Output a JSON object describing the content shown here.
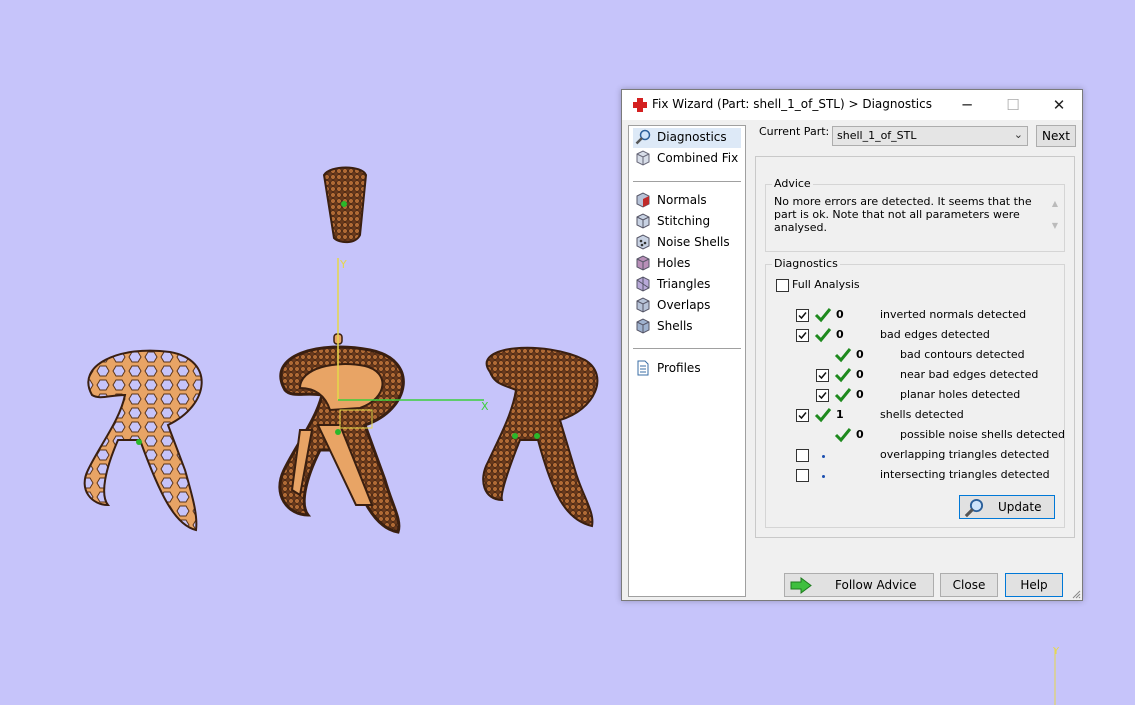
{
  "dialog": {
    "title": "Fix Wizard (Part: shell_1_of_STL) > Diagnostics",
    "window_controls": {
      "minimize": "─",
      "maximize": "☐",
      "close": "✕"
    }
  },
  "nav": {
    "top_items": [
      {
        "label": "Diagnostics",
        "icon": "magnifier-icon",
        "selected": true
      },
      {
        "label": "Combined Fix",
        "icon": "cube-icon"
      }
    ],
    "fix_items": [
      {
        "label": "Normals",
        "icon": "normals-cube-icon"
      },
      {
        "label": "Stitching",
        "icon": "stitching-cube-icon"
      },
      {
        "label": "Noise Shells",
        "icon": "noise-shells-icon"
      },
      {
        "label": "Holes",
        "icon": "holes-cube-icon"
      },
      {
        "label": "Triangles",
        "icon": "triangles-cube-icon"
      },
      {
        "label": "Overlaps",
        "icon": "overlaps-cube-icon"
      },
      {
        "label": "Shells",
        "icon": "shells-cube-icon"
      }
    ],
    "profiles": {
      "label": "Profiles",
      "icon": "document-icon"
    }
  },
  "current_part": {
    "label": "Current Part:",
    "value": "shell_1_of_STL",
    "next_label": "Next"
  },
  "advice": {
    "title": "Advice",
    "text": "No more errors are detected. It seems that the part is ok. Note that not all parameters were analysed."
  },
  "diagnostics": {
    "title": "Diagnostics",
    "full_analysis_label": "Full Analysis",
    "full_analysis_checked": false,
    "rows": [
      {
        "checkbox": true,
        "checked": true,
        "status": "ok",
        "count": "0",
        "text": "inverted normals detected",
        "indent": 0
      },
      {
        "checkbox": true,
        "checked": true,
        "status": "ok",
        "count": "0",
        "text": "bad edges detected",
        "indent": 0
      },
      {
        "checkbox": false,
        "checked": false,
        "status": "ok",
        "count": "0",
        "text": "bad contours detected",
        "indent": 1
      },
      {
        "checkbox": true,
        "checked": true,
        "status": "ok",
        "count": "0",
        "text": "near bad edges detected",
        "indent": 1
      },
      {
        "checkbox": true,
        "checked": true,
        "status": "ok",
        "count": "0",
        "text": "planar holes detected",
        "indent": 1
      },
      {
        "checkbox": true,
        "checked": true,
        "status": "ok",
        "count": "1",
        "text": "shells detected",
        "indent": 0
      },
      {
        "checkbox": false,
        "checked": false,
        "status": "ok",
        "count": "0",
        "text": "possible noise shells detected",
        "indent": 1
      },
      {
        "checkbox": true,
        "checked": false,
        "status": "dot",
        "count": "",
        "text": "overlapping triangles detected",
        "indent": 0
      },
      {
        "checkbox": true,
        "checked": false,
        "status": "dot",
        "count": "",
        "text": "intersecting triangles detected",
        "indent": 0
      }
    ],
    "update_label": "Update"
  },
  "footer": {
    "follow_advice_label": "Follow Advice",
    "close_label": "Close",
    "help_label": "Help"
  },
  "viewport": {
    "background": "#c6c4fa",
    "axis_labels": {
      "x": "X",
      "y": "Y"
    },
    "colors": {
      "jewelry": "#e8a465",
      "outline": "#3a1f10",
      "x_axis": "#3ccf3c",
      "y_axis": "#e6d84a"
    }
  }
}
